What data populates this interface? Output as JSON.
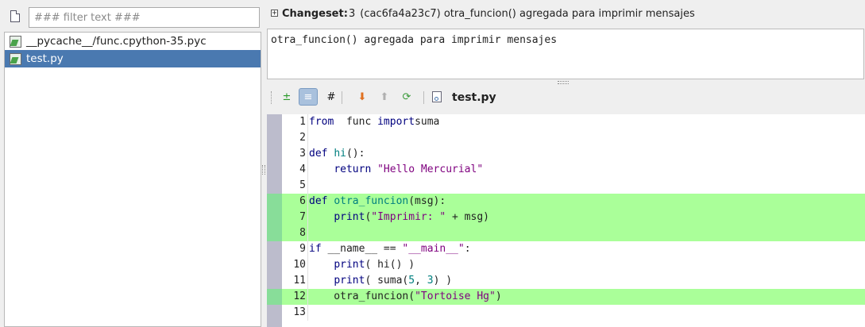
{
  "filter": {
    "placeholder": "### filter text ###",
    "value": ""
  },
  "files": [
    {
      "name": "__pycache__/func.cpython-35.pyc",
      "selected": false
    },
    {
      "name": "test.py",
      "selected": true
    }
  ],
  "changeset": {
    "label": "Changeset:",
    "number": "3",
    "summary": "(cac6fa4a23c7) otra_funcion() agregada para imprimir mensajes"
  },
  "description": "otra_funcion() agregada para imprimir mensajes",
  "toolbar": {
    "buttons": [
      {
        "name": "add-remove-icon",
        "glyph": "±",
        "color": "#2a9a2a"
      },
      {
        "name": "annotate-icon",
        "glyph": "≡",
        "color": "#ffffff",
        "active": true
      },
      {
        "name": "hash-icon",
        "glyph": "#",
        "color": "#111111"
      },
      {
        "name": "next-diff-icon",
        "glyph": "⬇",
        "color": "#e07020"
      },
      {
        "name": "prev-diff-icon",
        "glyph": "⬆",
        "color": "#b0b0b0"
      },
      {
        "name": "refresh-icon",
        "glyph": "⟳",
        "color": "#3a9a3a"
      }
    ],
    "file_name": "test.py"
  },
  "code_lines": [
    {
      "n": "1",
      "added": false,
      "tokens": [
        [
          "kw",
          "from"
        ],
        [
          "",
          "  func "
        ],
        [
          "kw",
          "import"
        ],
        [
          "",
          "",
          " "
        ],
        [
          "",
          "suma"
        ]
      ]
    },
    {
      "n": "2",
      "added": false,
      "tokens": []
    },
    {
      "n": "3",
      "added": false,
      "tokens": [
        [
          "kw",
          "def"
        ],
        [
          "",
          " "
        ],
        [
          "nm",
          "hi"
        ],
        [
          "",
          "():"
        ]
      ]
    },
    {
      "n": "4",
      "added": false,
      "tokens": [
        [
          "",
          "    "
        ],
        [
          "kw",
          "return"
        ],
        [
          "",
          " "
        ],
        [
          "st",
          "\"Hello Mercurial\""
        ]
      ]
    },
    {
      "n": "5",
      "added": false,
      "tokens": []
    },
    {
      "n": "6",
      "added": true,
      "tokens": [
        [
          "kw",
          "def"
        ],
        [
          "",
          " "
        ],
        [
          "nm",
          "otra_funcion"
        ],
        [
          "",
          "(msg):"
        ]
      ]
    },
    {
      "n": "7",
      "added": true,
      "tokens": [
        [
          "",
          "    "
        ],
        [
          "kw",
          "print"
        ],
        [
          "",
          "("
        ],
        [
          "st",
          "\"Imprimir: \""
        ],
        [
          "",
          " + msg)"
        ]
      ]
    },
    {
      "n": "8",
      "added": true,
      "tokens": []
    },
    {
      "n": "9",
      "added": false,
      "tokens": [
        [
          "kw",
          "if"
        ],
        [
          "",
          " __name__ == "
        ],
        [
          "st",
          "\"__main__\""
        ],
        [
          "",
          ":"
        ]
      ]
    },
    {
      "n": "10",
      "added": false,
      "tokens": [
        [
          "",
          "    "
        ],
        [
          "kw",
          "print"
        ],
        [
          "",
          "( hi() )"
        ]
      ]
    },
    {
      "n": "11",
      "added": false,
      "tokens": [
        [
          "",
          "    "
        ],
        [
          "kw",
          "print"
        ],
        [
          "",
          "( suma("
        ],
        [
          "nm",
          "5"
        ],
        [
          "",
          ", "
        ],
        [
          "nm",
          "3"
        ],
        [
          "",
          ") )"
        ]
      ]
    },
    {
      "n": "12",
      "added": true,
      "tokens": [
        [
          "",
          "    otra_funcion("
        ],
        [
          "st",
          "\"Tortoise Hg\""
        ],
        [
          "",
          ")"
        ]
      ]
    },
    {
      "n": "13",
      "added": false,
      "tokens": []
    }
  ]
}
